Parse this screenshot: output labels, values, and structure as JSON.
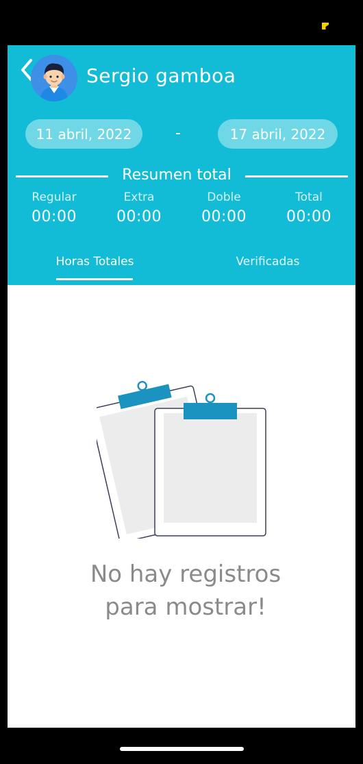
{
  "header": {
    "user_name": "Sergio gamboa",
    "date_start": "11 abril, 2022",
    "date_separator": "-",
    "date_end": "17 abril, 2022"
  },
  "summary": {
    "title": "Resumen total",
    "stats": [
      {
        "label": "Regular",
        "value": "00:00"
      },
      {
        "label": "Extra",
        "value": "00:00"
      },
      {
        "label": "Doble",
        "value": "00:00"
      },
      {
        "label": "Total",
        "value": "00:00"
      }
    ]
  },
  "tabs": [
    {
      "label": "Horas Totales",
      "active": true
    },
    {
      "label": "Verificadas",
      "active": false
    }
  ],
  "empty_state": {
    "line1": "No hay registros",
    "line2": "para mostrar!",
    "icon": "clipboard-icon"
  },
  "colors": {
    "header_bg": "#13bcd6",
    "chip_bg": "#6fd7e6",
    "clip_color": "#1a93c0",
    "message_text": "#8a8a8a"
  }
}
